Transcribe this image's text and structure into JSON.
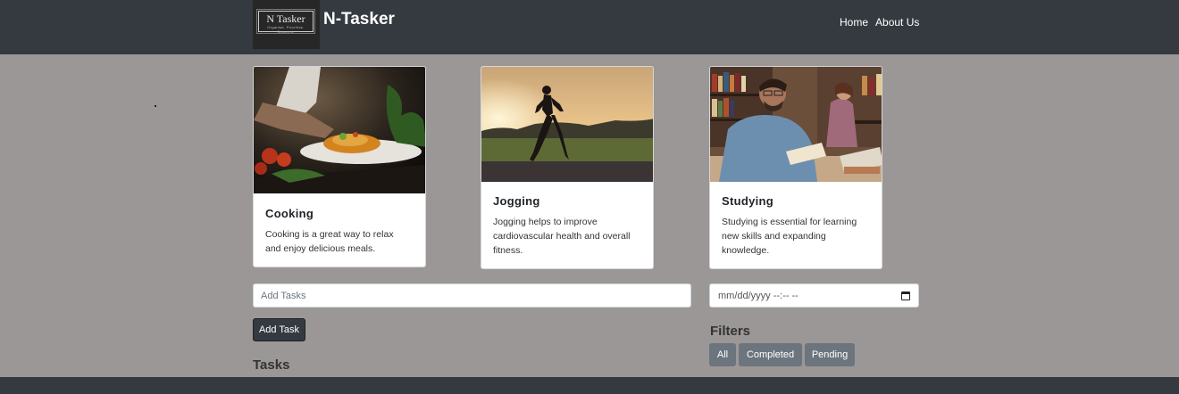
{
  "brand": {
    "logo_text": "N Tasker",
    "logo_tagline": "Organise. Prioritise. Succeed.",
    "name": "N-Tasker"
  },
  "nav": {
    "items": [
      "Home",
      "About Us"
    ]
  },
  "cards": [
    {
      "title": "Cooking",
      "text_lines": [
        "Cooking is a great way to relax",
        "and enjoy delicious meals."
      ]
    },
    {
      "title": "Jogging",
      "text_lines": [
        "Jogging helps to improve",
        "cardiovascular health and overall",
        "fitness."
      ]
    },
    {
      "title": "Studying",
      "text_lines": [
        "Studying is essential for learning",
        "new skills and expanding",
        "knowledge."
      ]
    }
  ],
  "task_input": {
    "placeholder": "Add Tasks",
    "value": ""
  },
  "date_input": {
    "placeholder": "mm/dd/yyyy --:-- --"
  },
  "add_button": "Add Task",
  "tasks_heading": "Tasks",
  "filters": {
    "heading": "Filters",
    "buttons": [
      "All",
      "Completed",
      "Pending"
    ]
  },
  "colors": {
    "navbar": "#343a40",
    "page_bg": "#9b9797",
    "filter_button": "#6c757d"
  }
}
